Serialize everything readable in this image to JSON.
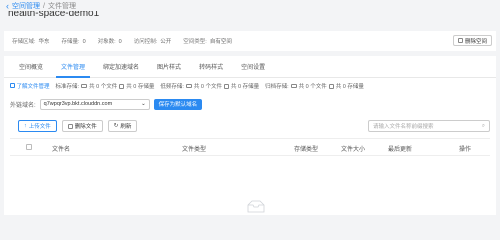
{
  "breadcrumb": {
    "back_icon": "chevron-left-icon",
    "root": "空间管理",
    "separator": "/",
    "current": "文件管理"
  },
  "page_title": "health-space-demo1",
  "space_info": {
    "items": [
      {
        "label": "存储区域:",
        "value": "华东"
      },
      {
        "label": "存储量:",
        "value": "0"
      },
      {
        "label": "对象数:",
        "value": "0"
      },
      {
        "label": "访问控制:",
        "value": "公开"
      },
      {
        "label": "空间类型:",
        "value": "自有空间"
      }
    ],
    "delete_button": "删除空间"
  },
  "tabs": [
    {
      "label": "空间概览",
      "active": false
    },
    {
      "label": "文件管理",
      "active": true
    },
    {
      "label": "绑定加速域名",
      "active": false
    },
    {
      "label": "图片样式",
      "active": false
    },
    {
      "label": "转码样式",
      "active": false
    },
    {
      "label": "空间设置",
      "active": false
    }
  ],
  "stats": {
    "learn_link": "了解文件管理",
    "items": [
      {
        "label": "标准存储:",
        "files": "共 0 个文件",
        "size": "共 0 存储量"
      },
      {
        "label": "低频存储:",
        "files": "共 0 个文件",
        "size": "共 0 存储量"
      },
      {
        "label": "归档存储:",
        "files": "共 0 个文件",
        "size": "共 0 存储量"
      }
    ]
  },
  "domain": {
    "label": "外链域名:",
    "value": "q7wpqr3vp.bkt.clouddn.com",
    "set_default_button": "保存为默认域名"
  },
  "toolbar": {
    "upload_button": "上传文件",
    "delete_button": "删除文件",
    "refresh_button": "刷新",
    "search_placeholder": "请输入文件名称前缀搜索"
  },
  "table": {
    "columns": [
      "文件名",
      "文件类型",
      "存储类型",
      "文件大小",
      "最后更新",
      "操作"
    ]
  },
  "colors": {
    "accent": "#2b8af1",
    "background": "#f3f4f6"
  }
}
